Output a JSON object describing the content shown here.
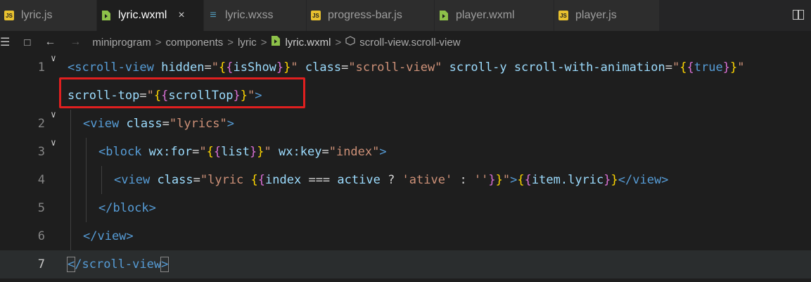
{
  "tabs": [
    {
      "label": "lyric.js",
      "type": "js",
      "active": false
    },
    {
      "label": "lyric.wxml",
      "type": "wxml",
      "active": true,
      "close": "×"
    },
    {
      "label": "lyric.wxss",
      "type": "wxss",
      "active": false
    },
    {
      "label": "progress-bar.js",
      "type": "js",
      "active": false
    },
    {
      "label": "player.wxml",
      "type": "wxml",
      "active": false
    },
    {
      "label": "player.js",
      "type": "js",
      "active": false
    }
  ],
  "breadcrumb": {
    "items": [
      "miniprogram",
      "components",
      "lyric",
      "lyric.wxml",
      "scroll-view.scroll-view"
    ],
    "separator": ">"
  },
  "editor": {
    "current_line": "7",
    "lines": [
      {
        "number": "1",
        "segments": [
          [
            "tag",
            "<scroll-view"
          ],
          [
            "pun",
            " "
          ],
          [
            "attr",
            "hidden"
          ],
          [
            "pun",
            "="
          ],
          [
            "str",
            "\""
          ],
          [
            "br1",
            "{"
          ],
          [
            "br2",
            "{"
          ],
          [
            "var",
            "isShow"
          ],
          [
            "br2",
            "}"
          ],
          [
            "br1",
            "}"
          ],
          [
            "str",
            "\""
          ],
          [
            "pun",
            " "
          ],
          [
            "attr",
            "class"
          ],
          [
            "pun",
            "="
          ],
          [
            "str",
            "\"scroll-view\""
          ],
          [
            "pun",
            " "
          ],
          [
            "attr",
            "scroll-y"
          ],
          [
            "pun",
            " "
          ],
          [
            "attr",
            "scroll-with-animation"
          ],
          [
            "pun",
            "="
          ],
          [
            "str",
            "\""
          ],
          [
            "br1",
            "{"
          ],
          [
            "br2",
            "{"
          ],
          [
            "kw",
            "true"
          ],
          [
            "br2",
            "}"
          ],
          [
            "br1",
            "}"
          ],
          [
            "str",
            "\""
          ]
        ]
      },
      {
        "number": "",
        "segments": [
          [
            "attr",
            "scroll-top"
          ],
          [
            "pun",
            "="
          ],
          [
            "str",
            "\""
          ],
          [
            "br1",
            "{"
          ],
          [
            "br2",
            "{"
          ],
          [
            "var",
            "scrollTop"
          ],
          [
            "br2",
            "}"
          ],
          [
            "br1",
            "}"
          ],
          [
            "str",
            "\""
          ],
          [
            "tag",
            ">"
          ]
        ]
      },
      {
        "number": "2",
        "segments": [
          [
            "tag",
            "<view"
          ],
          [
            "pun",
            " "
          ],
          [
            "attr",
            "class"
          ],
          [
            "pun",
            "="
          ],
          [
            "str",
            "\"lyrics\""
          ],
          [
            "tag",
            ">"
          ]
        ]
      },
      {
        "number": "3",
        "segments": [
          [
            "tag",
            "<block"
          ],
          [
            "pun",
            " "
          ],
          [
            "attr",
            "wx:for"
          ],
          [
            "pun",
            "="
          ],
          [
            "str",
            "\""
          ],
          [
            "br1",
            "{"
          ],
          [
            "br2",
            "{"
          ],
          [
            "var",
            "list"
          ],
          [
            "br2",
            "}"
          ],
          [
            "br1",
            "}"
          ],
          [
            "str",
            "\""
          ],
          [
            "pun",
            " "
          ],
          [
            "attr",
            "wx:key"
          ],
          [
            "pun",
            "="
          ],
          [
            "str",
            "\"index\""
          ],
          [
            "tag",
            ">"
          ]
        ]
      },
      {
        "number": "4",
        "segments": [
          [
            "tag",
            "<view"
          ],
          [
            "pun",
            " "
          ],
          [
            "attr",
            "class"
          ],
          [
            "pun",
            "="
          ],
          [
            "str",
            "\"lyric "
          ],
          [
            "br1",
            "{"
          ],
          [
            "br2",
            "{"
          ],
          [
            "var",
            "index"
          ],
          [
            "op",
            " === "
          ],
          [
            "var",
            "active"
          ],
          [
            "op",
            " ? "
          ],
          [
            "str",
            "'ative'"
          ],
          [
            "op",
            " : "
          ],
          [
            "str",
            "''"
          ],
          [
            "br2",
            "}"
          ],
          [
            "br1",
            "}"
          ],
          [
            "str",
            "\""
          ],
          [
            "tag",
            ">"
          ],
          [
            "br1",
            "{"
          ],
          [
            "br2",
            "{"
          ],
          [
            "var",
            "item.lyric"
          ],
          [
            "br2",
            "}"
          ],
          [
            "br1",
            "}"
          ],
          [
            "tag",
            "</view>"
          ]
        ]
      },
      {
        "number": "5",
        "segments": [
          [
            "tag",
            "</block>"
          ]
        ]
      },
      {
        "number": "6",
        "segments": [
          [
            "tag",
            "</view>"
          ]
        ]
      },
      {
        "number": "7",
        "segments": [
          [
            "tag",
            "<"
          ],
          [
            "tag",
            "/scroll-view"
          ],
          [
            "tag",
            ">"
          ]
        ]
      }
    ]
  },
  "icons": {
    "split": "split-editor-icon",
    "back": "←",
    "forward": "→",
    "list": "☰",
    "bookmark": "bookmark-icon"
  }
}
